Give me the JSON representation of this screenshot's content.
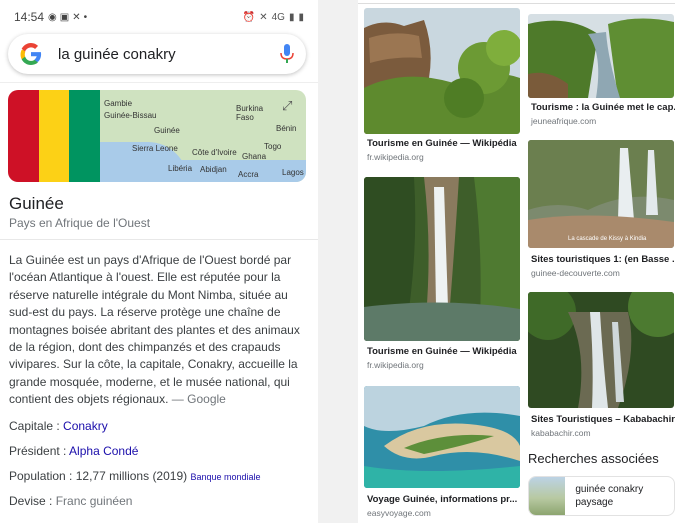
{
  "status_bar": {
    "time": "14:54",
    "network": "4G"
  },
  "search": {
    "query": "la guinée conakry"
  },
  "knowledge_panel": {
    "map_labels": [
      "Gambie",
      "Guinée-Bissau",
      "Guinée",
      "Sierra Leone",
      "Libéria",
      "Côte d'Ivoire",
      "Burkina Faso",
      "Bénin",
      "Ghana",
      "Togo",
      "Abidjan",
      "Accra",
      "Lagos"
    ],
    "title": "Guinée",
    "subtitle": "Pays en Afrique de l'Ouest",
    "description": "La Guinée est un pays d'Afrique de l'Ouest bordé par l'océan Atlantique à l'ouest. Elle est réputée pour la réserve naturelle intégrale du Mont Nimba, située au sud-est du pays. La réserve protège une chaîne de montagnes boisée abritant des plantes et des animaux de la région, dont des chimpanzés et des crapauds vivipares. Sur la côte, la capitale, Conakry, accueille la grande mosquée, moderne, et le musée national, qui contient des objets régionaux.",
    "description_source": "— Google",
    "facts": [
      {
        "key": "Capitale",
        "value": "Conakry",
        "extra": ""
      },
      {
        "key": "Président",
        "value": "Alpha Condé",
        "extra": ""
      },
      {
        "key": "Population",
        "value": "12,77 millions (2019)",
        "extra": "Banque mondiale"
      },
      {
        "key": "Devise",
        "value": "Franc guinéen",
        "extra": ""
      }
    ],
    "flag_colors": [
      "#ce1126",
      "#fcd116",
      "#009460"
    ]
  },
  "images": [
    {
      "caption": "Tourisme en Guinée — Wikipédia",
      "source": "fr.wikipedia.org"
    },
    {
      "caption": "Tourisme : la Guinée met le cap...",
      "source": "jeuneafrique.com"
    },
    {
      "caption": "Sites touristiques 1: (en Basse ...",
      "source": "guinee-decouverte.com",
      "overlay": "La cascade de Kissy à Kindia"
    },
    {
      "caption": "Tourisme en Guinée — Wikipédia",
      "source": "fr.wikipedia.org"
    },
    {
      "caption": "Sites Touristiques – Kababachir",
      "source": "kababachir.com"
    },
    {
      "caption": "Voyage Guinée, informations pr...",
      "source": "easyvoyage.com"
    }
  ],
  "related": {
    "title": "Recherches associées",
    "items": [
      {
        "label": "guinée conakry paysage"
      }
    ]
  }
}
